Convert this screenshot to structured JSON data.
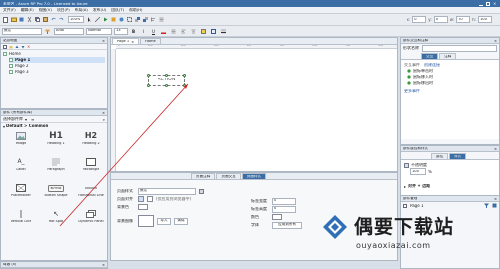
{
  "window": {
    "title": "未命名 - Axure RP Pro 7.0 - Licensed to Axure"
  },
  "menu": [
    "文件(F)",
    "编辑(E)",
    "视图(V)",
    "项目(P)",
    "布局(A)",
    "发布(U)",
    "团队(T)",
    "帮助(H)"
  ],
  "toolbar": {
    "zoom": "100%",
    "x": "0",
    "y": "0",
    "w": "70",
    "h": "100",
    "style": "默认",
    "font": "Arial",
    "weight": "Normal",
    "size": "13"
  },
  "sitemap": {
    "title": "站点地图",
    "items": [
      "Home",
      "Page 1",
      "Page 2",
      "Page 3"
    ]
  },
  "widgets": {
    "title": "部件 (所有部件库)",
    "library_label": "选择部件库",
    "section": "Default > Common",
    "items": [
      "Image",
      "Heading 1",
      "Heading 2",
      "Label",
      "Paragraph",
      "Rectangle",
      "Placeholder",
      "Button Shape",
      "Horizontal Line",
      "Vertical Line",
      "Hot Spot",
      "Dynamic Panel"
    ],
    "h1": "H1",
    "h2": "H2",
    "label_glyph": "A_",
    "hotspot_glyph": "↖",
    "button_glyph": "BUTTON"
  },
  "masters": {
    "title": "母版 (0)"
  },
  "canvas": {
    "tabs": [
      "Page 1",
      "Home"
    ],
    "ruler_marks": [
      "0",
      "100",
      "200",
      "300",
      "400",
      "500",
      "600",
      "700",
      "800"
    ],
    "action_label": "ACTION"
  },
  "bottom": {
    "tabs": [
      "页面注释",
      "页面交互",
      "页面样式"
    ],
    "style_label": "页面样式",
    "style_value": "默认",
    "align_label": "页面对齐",
    "bgcolor_label": "背景色",
    "bgimage_label": "背景图像",
    "import_btn": "导入",
    "clear_btn": "清除",
    "align_hint": "(仅应用到浏览器中)",
    "tag_width": "标签宽度",
    "tag_height": "标签高度",
    "field_value": "0",
    "fill": "颜色",
    "font": "字体",
    "apply_btn": "应用到所有"
  },
  "right": {
    "interact_title": "部件交互和注释",
    "name_label": "形状名称",
    "tabs": [
      "交互",
      "注释"
    ],
    "interact_label": "交互事件",
    "create_link": "创建连接",
    "events": [
      "鼠标单击时",
      "鼠标移入时",
      "鼠标移出时"
    ],
    "more_events": "更多事件",
    "props_title": "部件属性和样式",
    "props_tabs": [
      "属性",
      "样式"
    ],
    "opacity_label": "不透明度",
    "opacity_value": "100",
    "opacity_unit": "%",
    "align_label": "对齐 + 边距",
    "outline_title": "部件管理",
    "outline_page": "Page 1"
  },
  "watermark": {
    "brand": "偶要下载站",
    "url": "ouyaoxiazai.com"
  }
}
